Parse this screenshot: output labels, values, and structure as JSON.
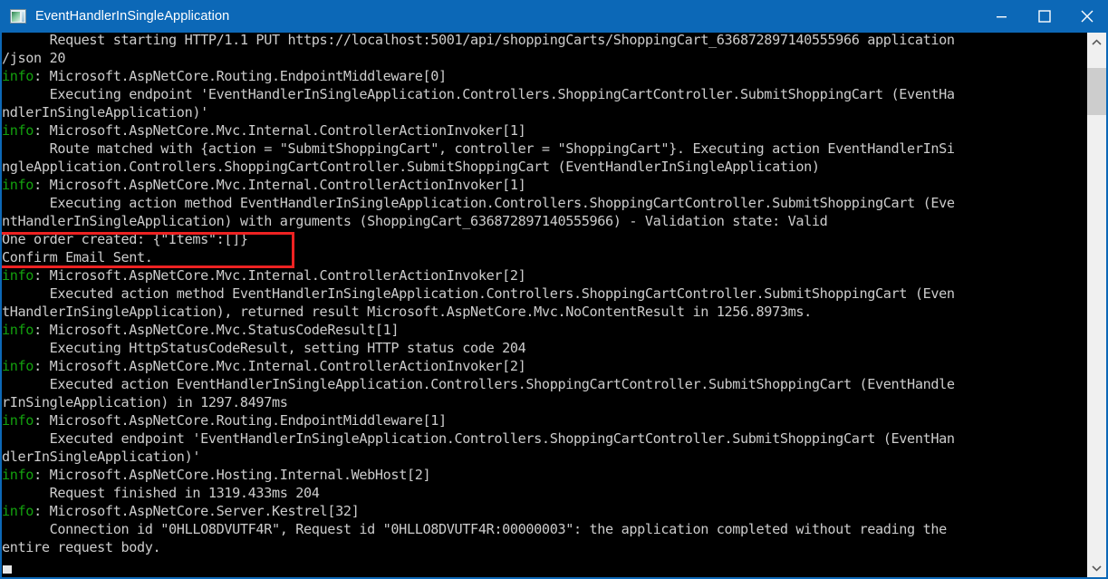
{
  "window": {
    "title": "EventHandlerInSingleApplication",
    "icon": "console-window-icon",
    "titlebar_color": "#0c68b7",
    "controls": {
      "minimize_label": "Minimize",
      "maximize_label": "Maximize",
      "close_label": "Close"
    }
  },
  "console": {
    "background": "#000000",
    "foreground": "#cccccc",
    "info_color": "#13a10e",
    "lines": [
      {
        "prefix": "",
        "text": "      Request starting HTTP/1.1 PUT https://localhost:5001/api/shoppingCarts/ShoppingCart_636872897140555966 application"
      },
      {
        "prefix": "",
        "text": "/json 20"
      },
      {
        "prefix": "info",
        "text": ": Microsoft.AspNetCore.Routing.EndpointMiddleware[0]"
      },
      {
        "prefix": "",
        "text": "      Executing endpoint 'EventHandlerInSingleApplication.Controllers.ShoppingCartController.SubmitShoppingCart (EventHa"
      },
      {
        "prefix": "",
        "text": "ndlerInSingleApplication)'"
      },
      {
        "prefix": "info",
        "text": ": Microsoft.AspNetCore.Mvc.Internal.ControllerActionInvoker[1]"
      },
      {
        "prefix": "",
        "text": "      Route matched with {action = \"SubmitShoppingCart\", controller = \"ShoppingCart\"}. Executing action EventHandlerInSi"
      },
      {
        "prefix": "",
        "text": "ngleApplication.Controllers.ShoppingCartController.SubmitShoppingCart (EventHandlerInSingleApplication)"
      },
      {
        "prefix": "info",
        "text": ": Microsoft.AspNetCore.Mvc.Internal.ControllerActionInvoker[1]"
      },
      {
        "prefix": "",
        "text": "      Executing action method EventHandlerInSingleApplication.Controllers.ShoppingCartController.SubmitShoppingCart (Eve"
      },
      {
        "prefix": "",
        "text": "ntHandlerInSingleApplication) with arguments (ShoppingCart_636872897140555966) - Validation state: Valid"
      },
      {
        "prefix": "",
        "text": "One order created: {\"Items\":[]}"
      },
      {
        "prefix": "",
        "text": "Confirm Email Sent."
      },
      {
        "prefix": "info",
        "text": ": Microsoft.AspNetCore.Mvc.Internal.ControllerActionInvoker[2]"
      },
      {
        "prefix": "",
        "text": "      Executed action method EventHandlerInSingleApplication.Controllers.ShoppingCartController.SubmitShoppingCart (Even"
      },
      {
        "prefix": "",
        "text": "tHandlerInSingleApplication), returned result Microsoft.AspNetCore.Mvc.NoContentResult in 1256.8973ms."
      },
      {
        "prefix": "info",
        "text": ": Microsoft.AspNetCore.Mvc.StatusCodeResult[1]"
      },
      {
        "prefix": "",
        "text": "      Executing HttpStatusCodeResult, setting HTTP status code 204"
      },
      {
        "prefix": "info",
        "text": ": Microsoft.AspNetCore.Mvc.Internal.ControllerActionInvoker[2]"
      },
      {
        "prefix": "",
        "text": "      Executed action EventHandlerInSingleApplication.Controllers.ShoppingCartController.SubmitShoppingCart (EventHandle"
      },
      {
        "prefix": "",
        "text": "rInSingleApplication) in 1297.8497ms"
      },
      {
        "prefix": "info",
        "text": ": Microsoft.AspNetCore.Routing.EndpointMiddleware[1]"
      },
      {
        "prefix": "",
        "text": "      Executed endpoint 'EventHandlerInSingleApplication.Controllers.ShoppingCartController.SubmitShoppingCart (EventHan"
      },
      {
        "prefix": "",
        "text": "dlerInSingleApplication)'"
      },
      {
        "prefix": "info",
        "text": ": Microsoft.AspNetCore.Hosting.Internal.WebHost[2]"
      },
      {
        "prefix": "",
        "text": "      Request finished in 1319.433ms 204"
      },
      {
        "prefix": "info",
        "text": ": Microsoft.AspNetCore.Server.Kestrel[32]"
      },
      {
        "prefix": "",
        "text": "      Connection id \"0HLLO8DVUTF4R\", Request id \"0HLLO8DVUTF4R:00000003\": the application completed without reading the"
      },
      {
        "prefix": "",
        "text": "entire request body."
      }
    ],
    "annotation": {
      "name": "red-highlight-box",
      "color": "#ee2222",
      "highlighted_lines": [
        "One order created: {\"Items\":[]}",
        "Confirm Email Sent."
      ]
    }
  },
  "scrollbar": {
    "up_arrow": "chevron-up-icon",
    "down_arrow": "chevron-down-icon",
    "track_color": "#f0f0f0",
    "thumb_color": "#cdcdcd"
  }
}
